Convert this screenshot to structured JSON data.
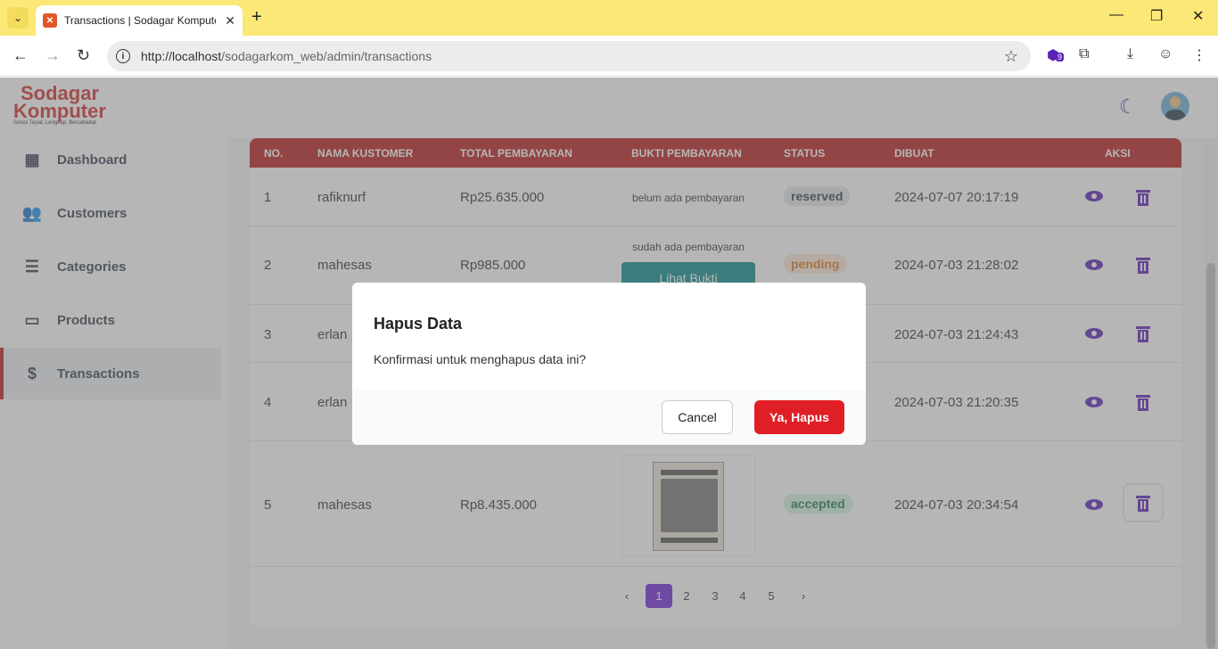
{
  "browser": {
    "tab_title": "Transactions | Sodagar Komputer",
    "url_host": "http://localhost",
    "url_path": "/sodagarkom_web/admin/transactions",
    "ext_badge": "9"
  },
  "brand": {
    "line1": "Sodagar",
    "line2": "Komputer",
    "tagline": "Solusi Tepat, Lengkap, Bersahabat"
  },
  "sidebar": {
    "items": [
      {
        "label": "Dashboard",
        "icon": "dashboard-icon"
      },
      {
        "label": "Customers",
        "icon": "users-icon"
      },
      {
        "label": "Categories",
        "icon": "list-icon"
      },
      {
        "label": "Products",
        "icon": "monitor-icon"
      },
      {
        "label": "Transactions",
        "icon": "dollar-icon"
      }
    ]
  },
  "table": {
    "headers": [
      "NO.",
      "NAMA KUSTOMER",
      "TOTAL PEMBAYARAN",
      "BUKTI PEMBAYARAN",
      "STATUS",
      "DIBUAT",
      "AKSI"
    ],
    "rows": [
      {
        "no": "1",
        "name": "rafiknurf",
        "total": "Rp25.635.000",
        "bukti": "belum ada pembayaran",
        "status": "reserved",
        "created": "2024-07-07 20:17:19"
      },
      {
        "no": "2",
        "name": "mahesas",
        "total": "Rp985.000",
        "bukti": "sudah ada pembayaran",
        "bukti_btn": "Lihat Bukti",
        "status": "pending",
        "created": "2024-07-03 21:28:02"
      },
      {
        "no": "3",
        "name": "erlan",
        "created": "2024-07-03 21:24:43"
      },
      {
        "no": "4",
        "name": "erlan",
        "created": "2024-07-03 21:20:35"
      },
      {
        "no": "5",
        "name": "mahesas",
        "total": "Rp8.435.000",
        "status": "accepted",
        "created": "2024-07-03 20:34:54"
      }
    ]
  },
  "pagination": {
    "prev": "‹",
    "pages": [
      "1",
      "2",
      "3",
      "4",
      "5"
    ],
    "next": "›",
    "active": "1"
  },
  "modal": {
    "title": "Hapus Data",
    "message": "Konfirmasi untuk menghapus data ini?",
    "cancel": "Cancel",
    "confirm": "Ya, Hapus"
  },
  "colors": {
    "primary": "#b91c1c",
    "accent": "#6d28d9",
    "danger": "#e01e26"
  }
}
